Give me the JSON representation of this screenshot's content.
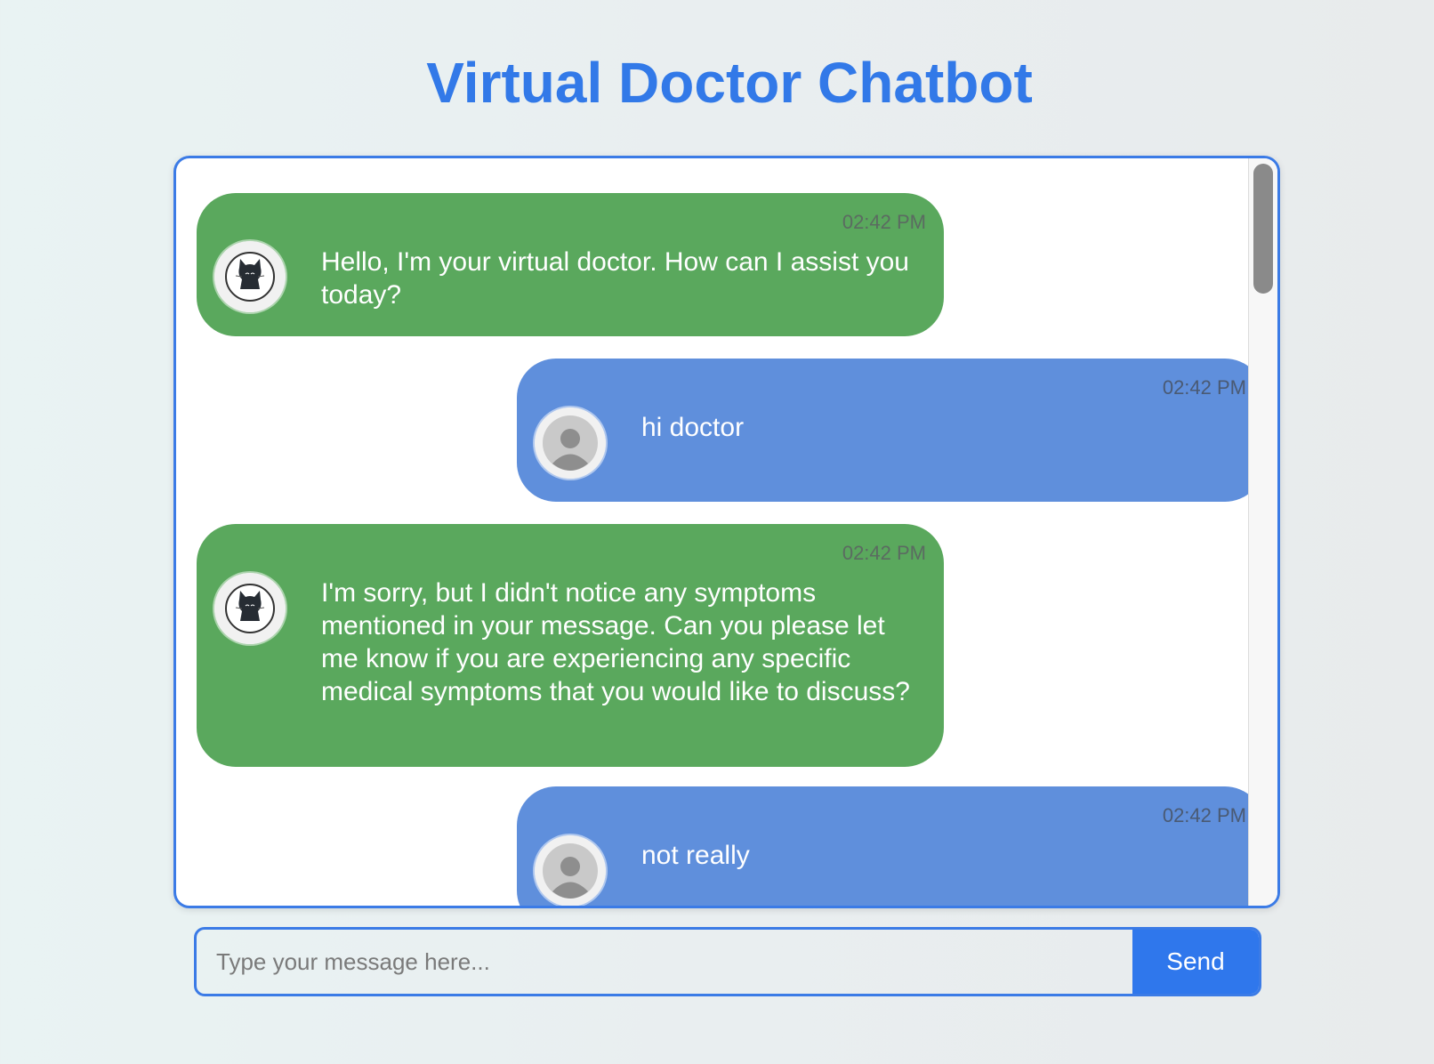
{
  "page": {
    "title": "Virtual Doctor Chatbot"
  },
  "colors": {
    "accent": "#3b7be6",
    "bot_bubble": "#5aa85d",
    "user_bubble": "#5f8fdc",
    "send_button": "#2f77ec"
  },
  "messages": [
    {
      "sender": "bot",
      "avatar_icon": "cat-avatar-icon",
      "timestamp": "02:42 PM",
      "text": "Hello, I'm your virtual doctor. How can I assist you today?"
    },
    {
      "sender": "user",
      "avatar_icon": "user-avatar-icon",
      "timestamp": "02:42 PM",
      "text": "hi doctor"
    },
    {
      "sender": "bot",
      "avatar_icon": "cat-avatar-icon",
      "timestamp": "02:42 PM",
      "text": "I'm sorry, but I didn't notice any symptoms mentioned in your message. Can you please let me know if you are experiencing any specific medical symptoms that you would like to discuss?"
    },
    {
      "sender": "user",
      "avatar_icon": "user-avatar-icon",
      "timestamp": "02:42 PM",
      "text": "not really"
    }
  ],
  "composer": {
    "placeholder": "Type your message here...",
    "value": "",
    "send_label": "Send"
  }
}
